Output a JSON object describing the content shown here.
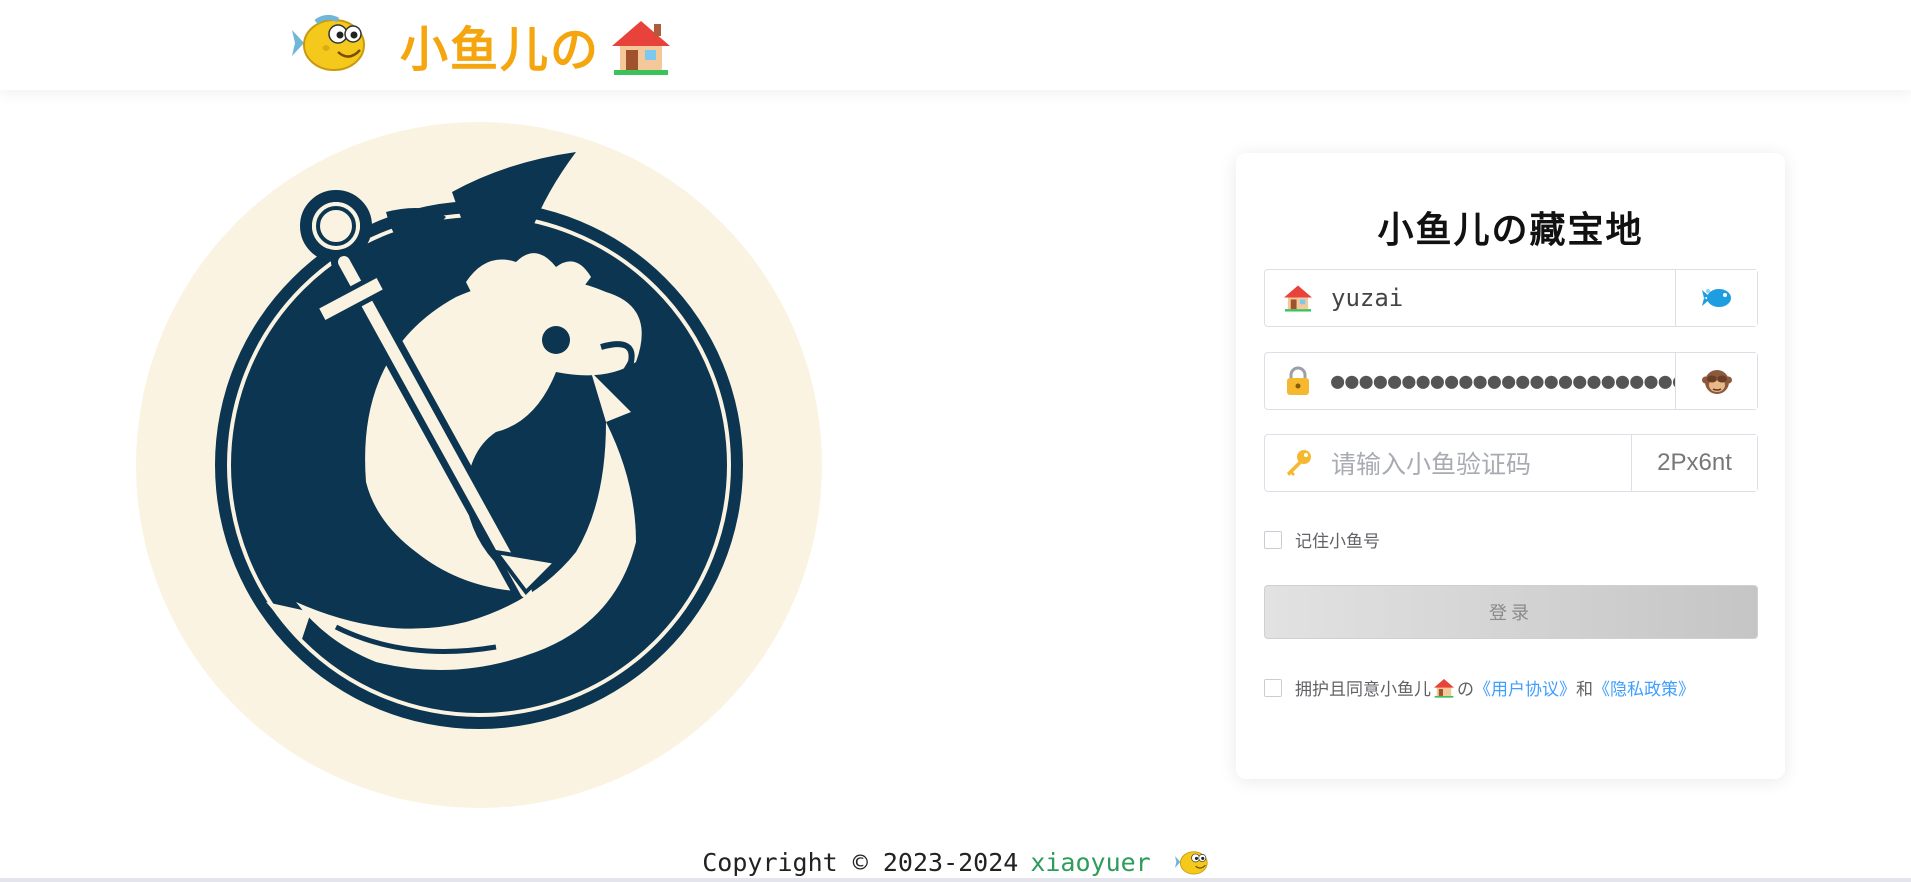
{
  "header": {
    "brand_text": "小鱼儿の",
    "logo_icon": "cartoon-fish-icon",
    "house_icon": "house-icon"
  },
  "hero": {
    "icon": "fish-anchor-emblem",
    "colors": {
      "navy": "#0b3550",
      "cream": "#fbf3e1"
    }
  },
  "login": {
    "title": "小鱼儿の藏宝地",
    "username": {
      "value": "yuzai",
      "prefix_icon": "house-icon",
      "append_icon": "blue-fish-icon"
    },
    "password": {
      "value": "●●●●●●●●●●●●●●●●●●●●●●●●●●",
      "prefix_icon": "lock-icon",
      "append_icon": "see-no-evil-monkey-icon"
    },
    "captcha": {
      "placeholder": "请输入小鱼验证码",
      "prefix_icon": "key-icon",
      "code": "2Px6nt"
    },
    "remember_label": "记住小鱼号",
    "login_button": "登录",
    "agree": {
      "prefix": "拥护且同意小鱼儿",
      "middle": "の",
      "user_agreement": "《用户协议》",
      "and": "和",
      "privacy_policy": "《隐私政策》"
    }
  },
  "footer": {
    "copyright": "Copyright © 2023-2024",
    "name": "xiaoyuer",
    "icon": "cartoon-fish-icon"
  },
  "colors": {
    "brand_orange": "#f5a50d",
    "link_blue": "#409eff",
    "footer_green": "#2e9c5a"
  }
}
